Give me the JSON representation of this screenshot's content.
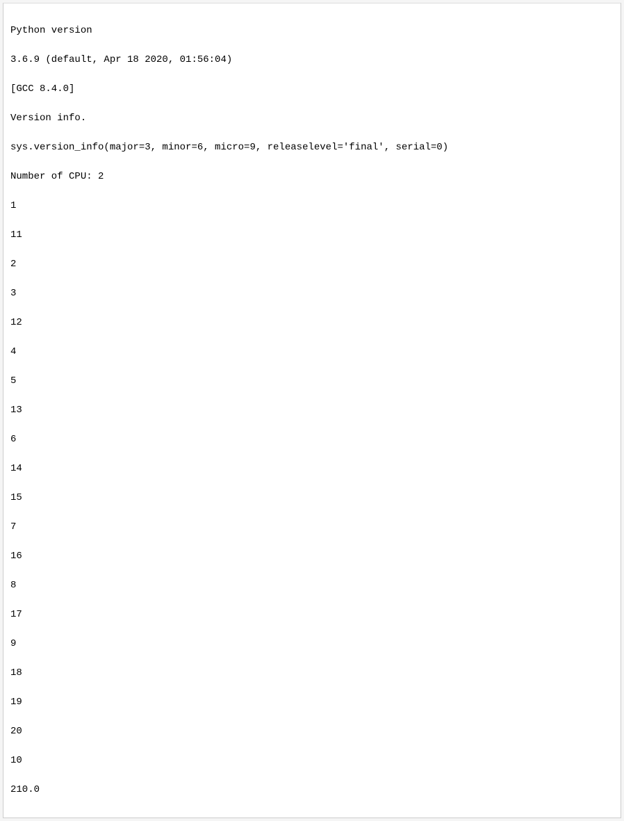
{
  "output": {
    "header": {
      "line1": "Python version",
      "line2": "3.6.9 (default, Apr 18 2020, 01:56:04)",
      "line3": "[GCC 8.4.0]",
      "line4": "Version info.",
      "line5": "sys.version_info(major=3, minor=6, micro=9, releaselevel='final', serial=0)",
      "line6": "Number of CPU: 2"
    },
    "values": {
      "v0": "1",
      "v1": "11",
      "v2": "2",
      "v3": "3",
      "v4": "12",
      "v5": "4",
      "v6": "5",
      "v7": "13",
      "v8": "6",
      "v9": "14",
      "v10": "15",
      "v11": "7",
      "v12": "16",
      "v13": "8",
      "v14": "17",
      "v15": "9",
      "v16": "18",
      "v17": "19",
      "v18": "20",
      "v19": "10",
      "v20": "210.0"
    }
  }
}
